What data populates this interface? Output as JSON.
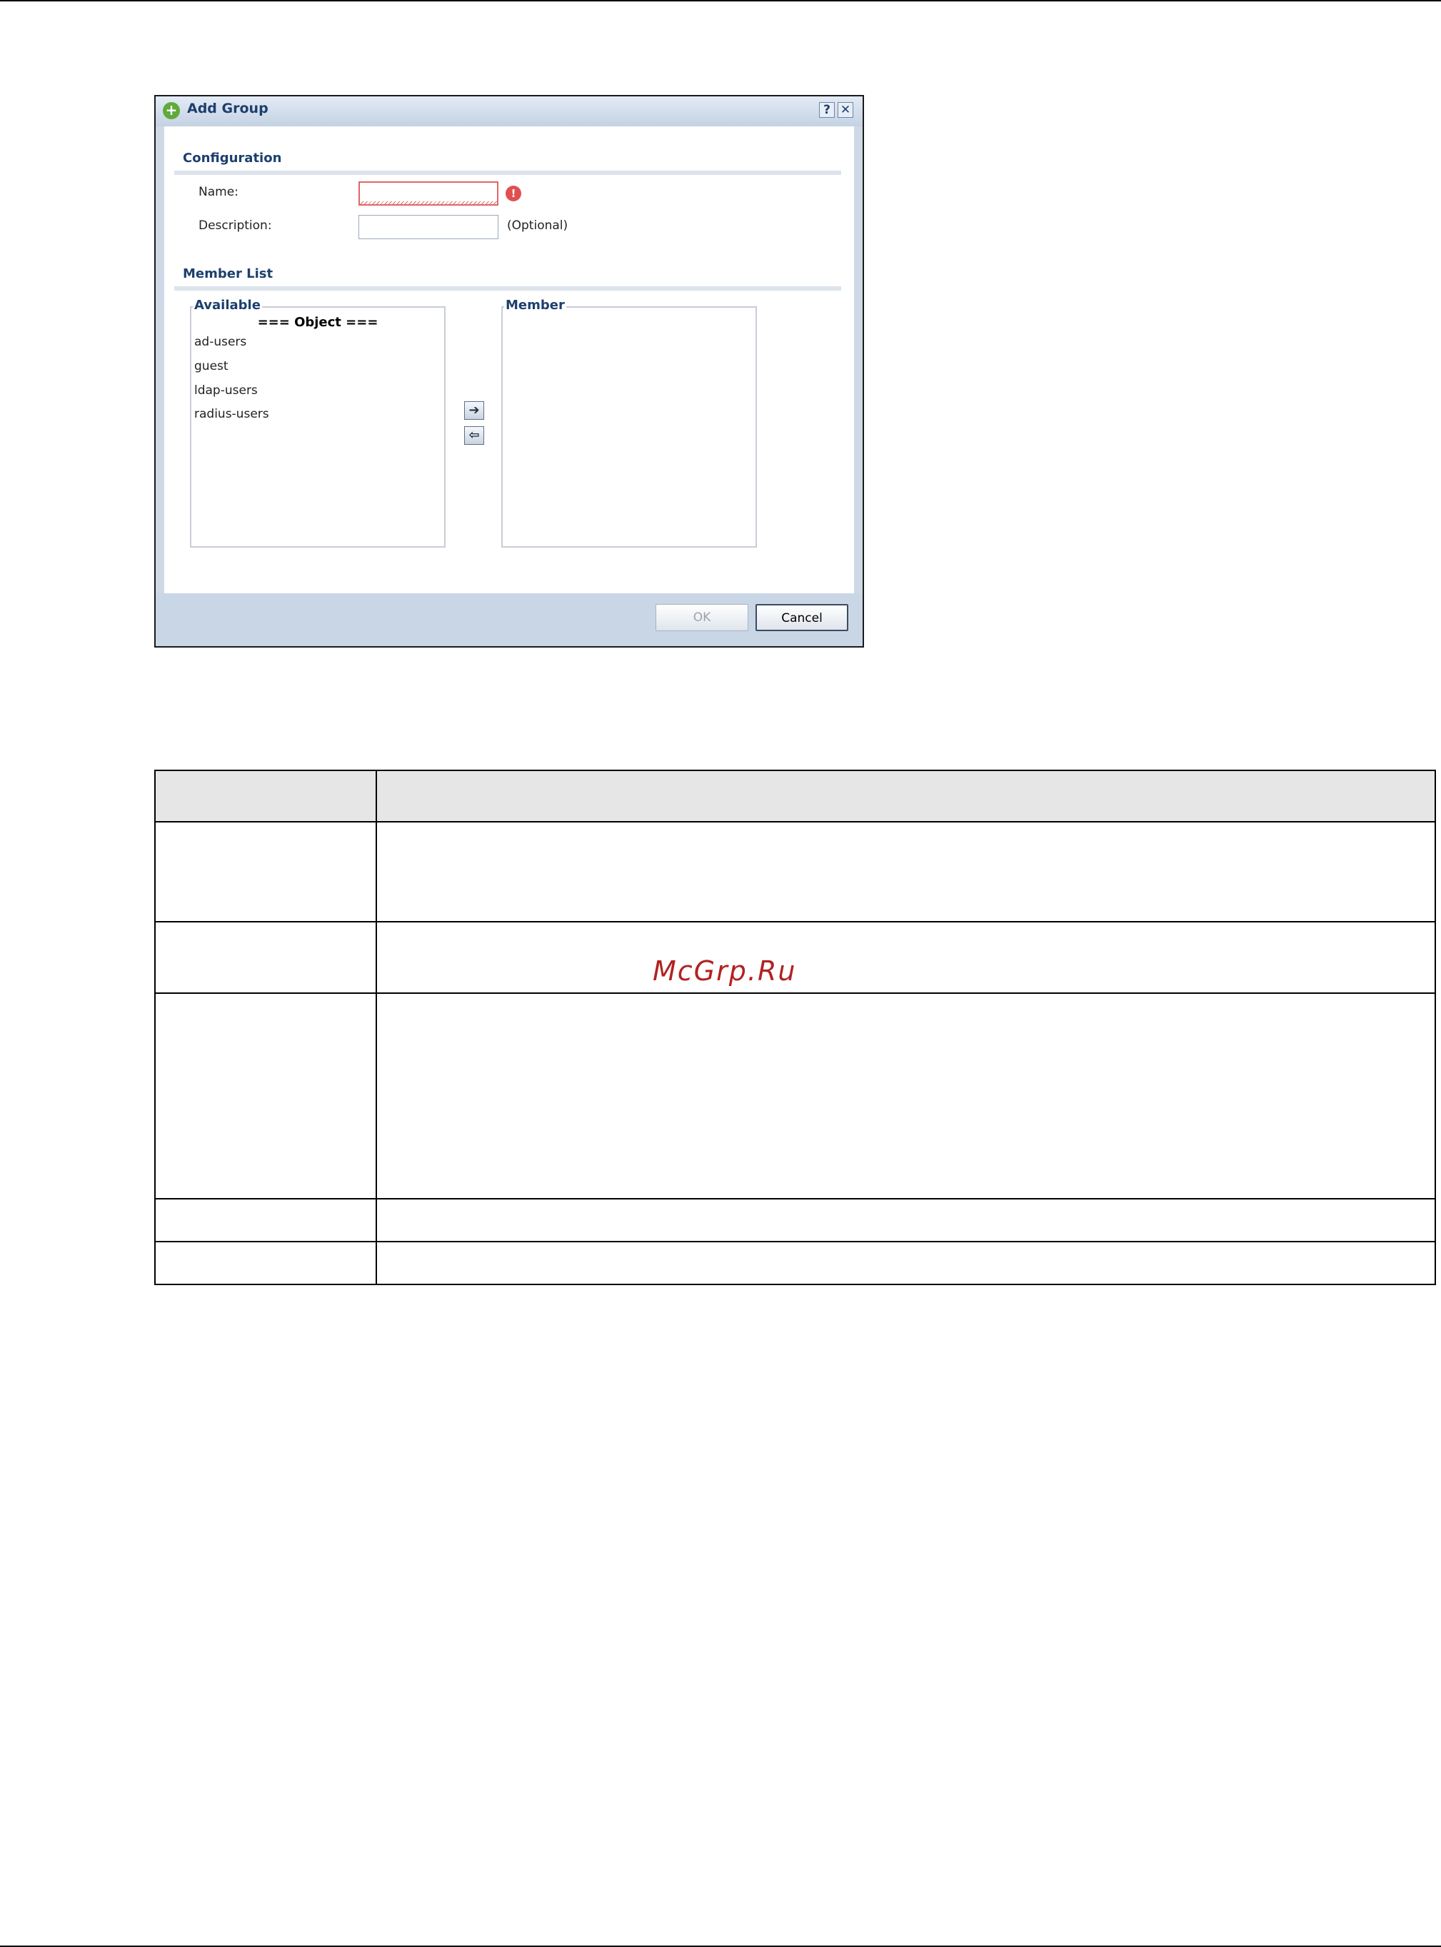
{
  "dialog": {
    "title": "Add Group",
    "help_label": "?",
    "close_label": "✕",
    "configuration": {
      "title": "Configuration",
      "name_label": "Name:",
      "name_value": "",
      "description_label": "Description:",
      "description_value": "",
      "optional_label": "(Optional)"
    },
    "member_list": {
      "title": "Member List",
      "available_label": "Available",
      "available_header": "=== Object ===",
      "available_items": [
        "ad-users",
        "guest",
        "ldap-users",
        "radius-users"
      ],
      "member_label": "Member",
      "add_arrow": "➔",
      "remove_arrow": "⇦"
    },
    "ok_label": "OK",
    "cancel_label": "Cancel"
  },
  "watermark": "McGrp.Ru"
}
